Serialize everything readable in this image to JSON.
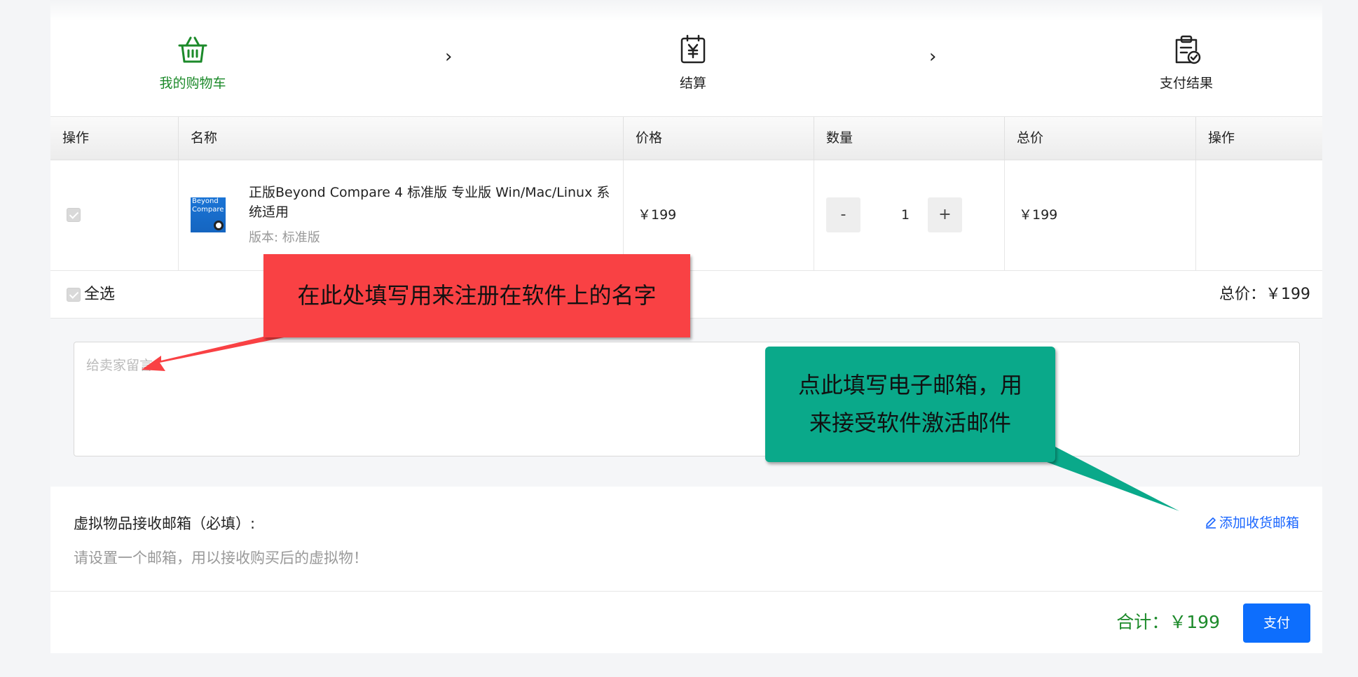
{
  "steps": [
    {
      "label": "我的购物车",
      "icon": "basket-icon",
      "active": true
    },
    {
      "label": "结算",
      "icon": "yuan-calendar-icon",
      "active": false
    },
    {
      "label": "支付结果",
      "icon": "clipboard-check-icon",
      "active": false
    }
  ],
  "table": {
    "headers": [
      "操作",
      "名称",
      "价格",
      "数量",
      "总价",
      "操作"
    ],
    "row": {
      "checked": true,
      "product_name": "正版Beyond Compare 4 标准版 专业版 Win/Mac/Linux 系统适用",
      "version": "版本: 标准版",
      "thumb_text": [
        "Beyond",
        "Compare"
      ],
      "price": "￥199",
      "qty_minus": "-",
      "qty": "1",
      "qty_plus": "+",
      "total": "￥199"
    }
  },
  "select_all": {
    "label": "全选",
    "total": "总价：￥199"
  },
  "message": {
    "placeholder": "给卖家留言"
  },
  "email": {
    "title": "虚拟物品接收邮箱（必填）:",
    "hint": "请设置一个邮箱，用以接收购买后的虚拟物！",
    "add_label": "添加收货邮箱"
  },
  "footer": {
    "sum": "合计：￥199",
    "pay_label": "支付"
  },
  "annotations": {
    "red": "在此处填写用来注册在软件上的名字",
    "green_line1": "点此填写电子邮箱，用",
    "green_line2": "来接受软件激活邮件"
  },
  "colors": {
    "accent_green": "#1c8a2a",
    "primary_blue": "#0d6efd",
    "callout_red": "#f94144",
    "callout_green": "#0aa98a"
  }
}
